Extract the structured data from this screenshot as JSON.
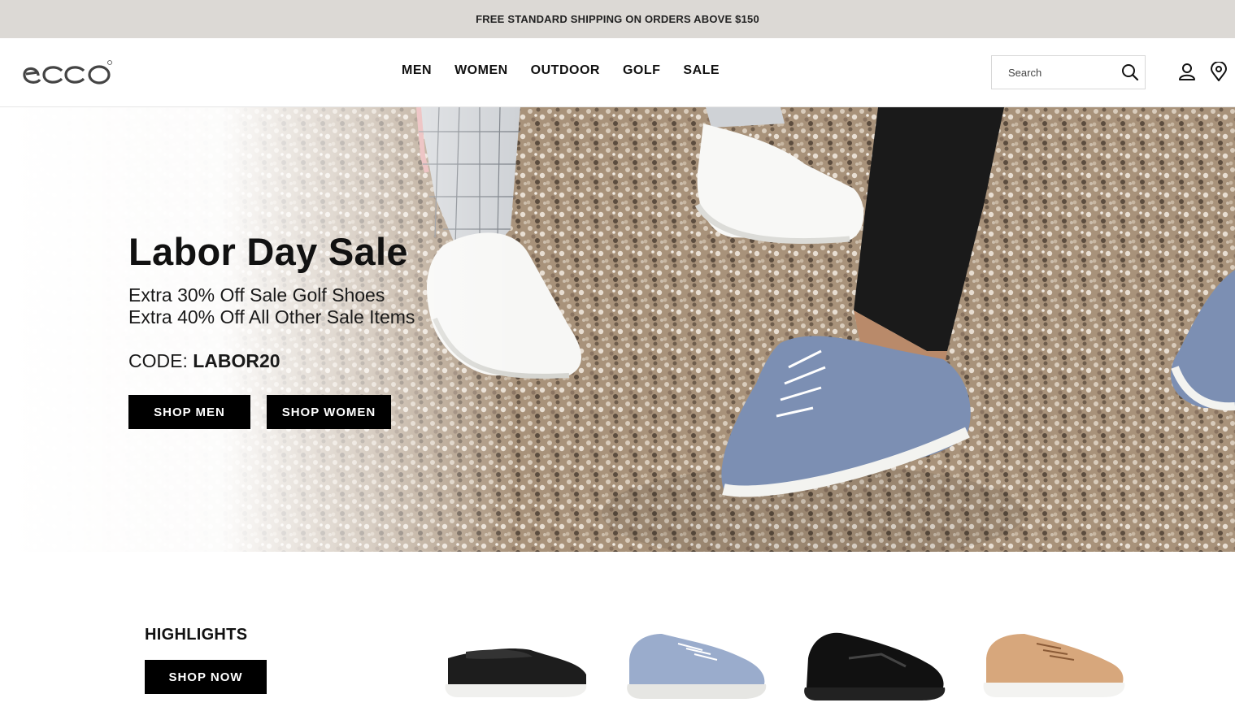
{
  "promo_bar": {
    "text": "FREE STANDARD SHIPPING ON ORDERS ABOVE $150"
  },
  "header": {
    "logo_text": "ecco",
    "nav": [
      "MEN",
      "WOMEN",
      "OUTDOOR",
      "GOLF",
      "SALE"
    ],
    "search": {
      "placeholder": "Search"
    },
    "icons": [
      "search-icon",
      "account-icon",
      "store-locator-icon"
    ]
  },
  "hero": {
    "title": "Labor Day Sale",
    "line1": "Extra 30% Off Sale Golf Shoes",
    "line2": "Extra 40% Off All Other Sale Items",
    "code_label": "CODE:",
    "code_value": "LABOR20",
    "buttons": [
      "SHOP MEN",
      "SHOP WOMEN"
    ]
  },
  "highlights": {
    "title": "HIGHLIGHTS",
    "button": "SHOP NOW",
    "products": [
      "black-slip-on-shoe",
      "blue-metallic-sneaker",
      "black-athletic-sneaker",
      "tan-suede-sneaker"
    ]
  },
  "colors": {
    "promo_bg": "#dcd9d5",
    "button_bg": "#000000",
    "button_text": "#ffffff"
  }
}
